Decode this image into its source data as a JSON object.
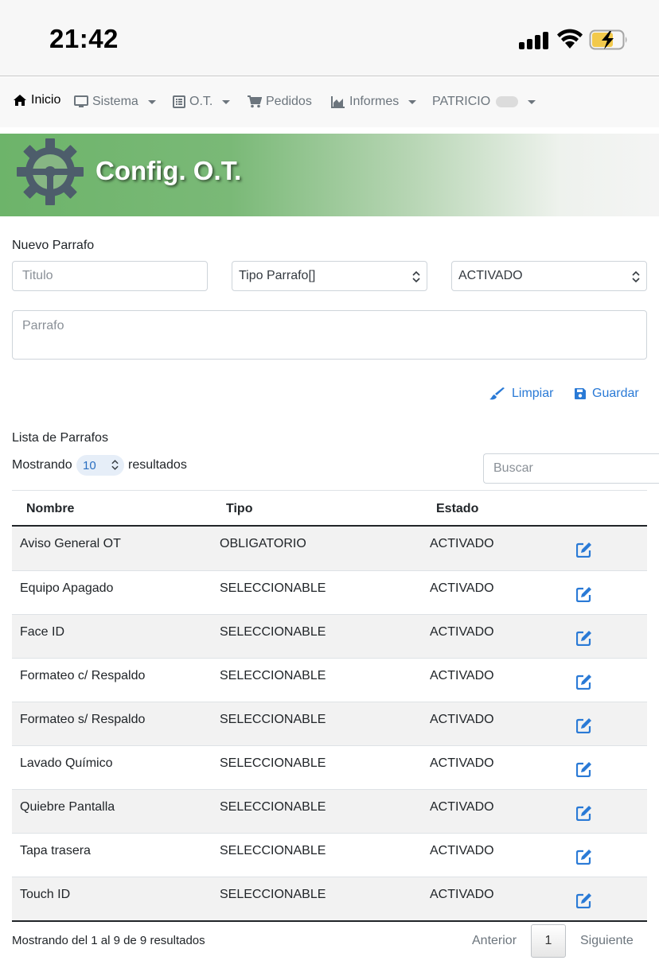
{
  "status_bar": {
    "time": "21:42"
  },
  "nav": {
    "items": [
      {
        "label": "Inicio",
        "icon": "home-icon"
      },
      {
        "label": "Sistema",
        "icon": "monitor-icon"
      },
      {
        "label": "O.T.",
        "icon": "list-icon"
      },
      {
        "label": "Pedidos",
        "icon": "cart-icon"
      },
      {
        "label": "Informes",
        "icon": "area-chart-icon"
      },
      {
        "label": "PATRICIO"
      }
    ]
  },
  "banner": {
    "title": "Config. O.T.",
    "icon": "gear-icon"
  },
  "form": {
    "section_label": "Nuevo Parrafo",
    "titulo_placeholder": "Titulo",
    "tipo_value": "Tipo Parrafo[]",
    "estado_value": "ACTIVADO",
    "parrafo_placeholder": "Parrafo",
    "limpiar_label": "Limpiar",
    "guardar_label": "Guardar"
  },
  "list": {
    "section_label": "Lista de Parrafos",
    "showing_prefix": "Mostrando",
    "page_length": "10",
    "showing_suffix": "resultados",
    "search_placeholder": "Buscar",
    "columns": [
      "Nombre",
      "Tipo",
      "Estado"
    ],
    "rows": [
      {
        "nombre": "Aviso General OT",
        "tipo": "OBLIGATORIO",
        "estado": "ACTIVADO"
      },
      {
        "nombre": "Equipo Apagado",
        "tipo": "SELECCIONABLE",
        "estado": "ACTIVADO"
      },
      {
        "nombre": "Face ID",
        "tipo": "SELECCIONABLE",
        "estado": "ACTIVADO"
      },
      {
        "nombre": "Formateo c/ Respaldo",
        "tipo": "SELECCIONABLE",
        "estado": "ACTIVADO"
      },
      {
        "nombre": "Formateo s/ Respaldo",
        "tipo": "SELECCIONABLE",
        "estado": "ACTIVADO"
      },
      {
        "nombre": "Lavado Químico",
        "tipo": "SELECCIONABLE",
        "estado": "ACTIVADO"
      },
      {
        "nombre": "Quiebre Pantalla",
        "tipo": "SELECCIONABLE",
        "estado": "ACTIVADO"
      },
      {
        "nombre": "Tapa trasera",
        "tipo": "SELECCIONABLE",
        "estado": "ACTIVADO"
      },
      {
        "nombre": "Touch ID",
        "tipo": "SELECCIONABLE",
        "estado": "ACTIVADO"
      }
    ],
    "info": "Mostrando del 1 al 9 de 9 resultados",
    "prev_label": "Anterior",
    "current_page": "1",
    "next_label": "Siguiente"
  },
  "colors": {
    "accent": "#2a7ad6",
    "banner_green": "#6db46a",
    "gear": "#4d5d6b"
  }
}
